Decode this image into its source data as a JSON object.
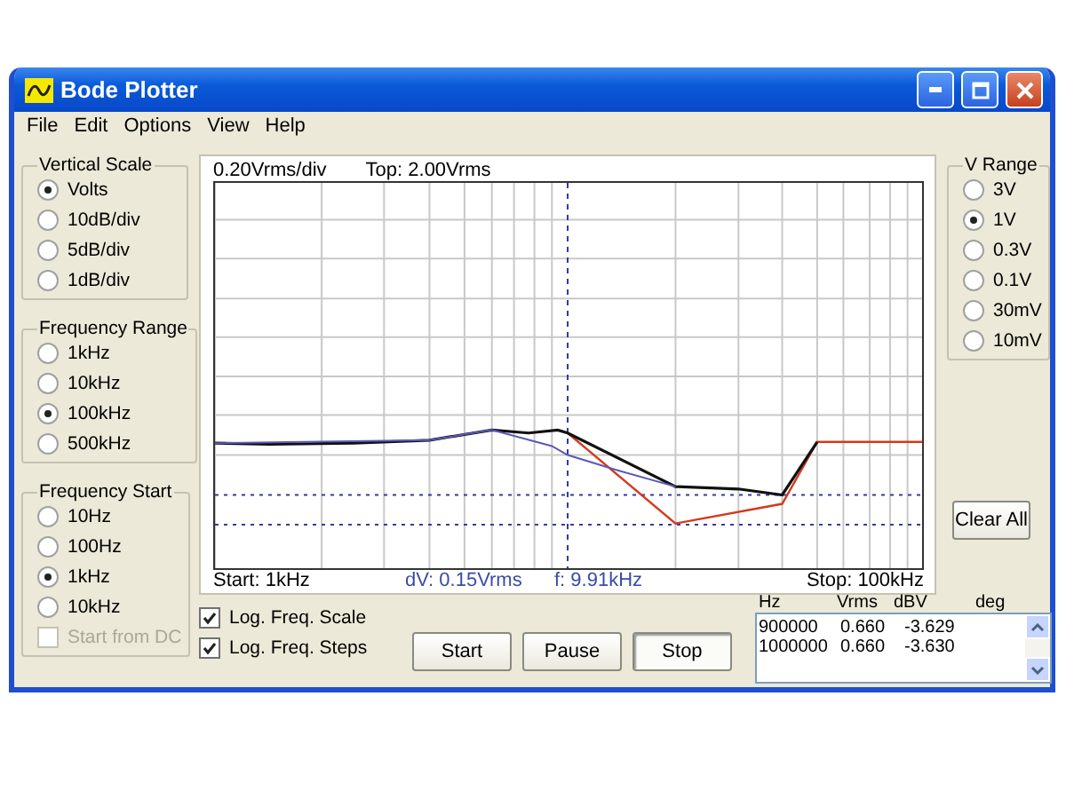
{
  "window": {
    "title": "Bode Plotter"
  },
  "menu": [
    "File",
    "Edit",
    "Options",
    "View",
    "Help"
  ],
  "vertical_scale": {
    "label": "Vertical Scale",
    "options": [
      {
        "label": "Volts",
        "selected": true
      },
      {
        "label": "10dB/div",
        "selected": false
      },
      {
        "label": "5dB/div",
        "selected": false
      },
      {
        "label": "1dB/div",
        "selected": false
      }
    ]
  },
  "frequency_range": {
    "label": "Frequency Range",
    "options": [
      {
        "label": "1kHz",
        "selected": false
      },
      {
        "label": "10kHz",
        "selected": false
      },
      {
        "label": "100kHz",
        "selected": true
      },
      {
        "label": "500kHz",
        "selected": false
      }
    ]
  },
  "frequency_start": {
    "label": "Frequency Start",
    "options": [
      {
        "label": "10Hz",
        "selected": false
      },
      {
        "label": "100Hz",
        "selected": false
      },
      {
        "label": "1kHz",
        "selected": true
      },
      {
        "label": "10kHz",
        "selected": false
      }
    ],
    "start_from_dc": {
      "label": "Start from DC",
      "checked": false,
      "disabled": true
    }
  },
  "plot": {
    "scale": "0.20Vrms/div",
    "top": "Top: 2.00Vrms",
    "start": "Start: 1kHz",
    "dv": "dV: 0.15Vrms",
    "f": "f: 9.91kHz",
    "stop": "Stop: 100kHz"
  },
  "options": [
    {
      "label": "Log. Freq. Scale",
      "checked": true
    },
    {
      "label": "Log. Freq. Steps",
      "checked": true
    }
  ],
  "buttons": [
    {
      "label": "Start",
      "pressed": false
    },
    {
      "label": "Pause",
      "pressed": false
    },
    {
      "label": "Stop",
      "pressed": true
    }
  ],
  "results": {
    "columns": [
      "Hz",
      "Vrms",
      "dBV",
      "deg"
    ],
    "rows": [
      [
        "900000",
        "0.660",
        "-3.629"
      ],
      [
        "1000000",
        "0.660",
        "-3.630"
      ]
    ]
  },
  "v_range": {
    "label": "V Range",
    "options": [
      {
        "label": "3V",
        "selected": false
      },
      {
        "label": "1V",
        "selected": true
      },
      {
        "label": "0.3V",
        "selected": false
      },
      {
        "label": "0.1V",
        "selected": false
      },
      {
        "label": "30mV",
        "selected": false
      },
      {
        "label": "10mV",
        "selected": false
      }
    ]
  },
  "clear_all": "Clear All"
}
